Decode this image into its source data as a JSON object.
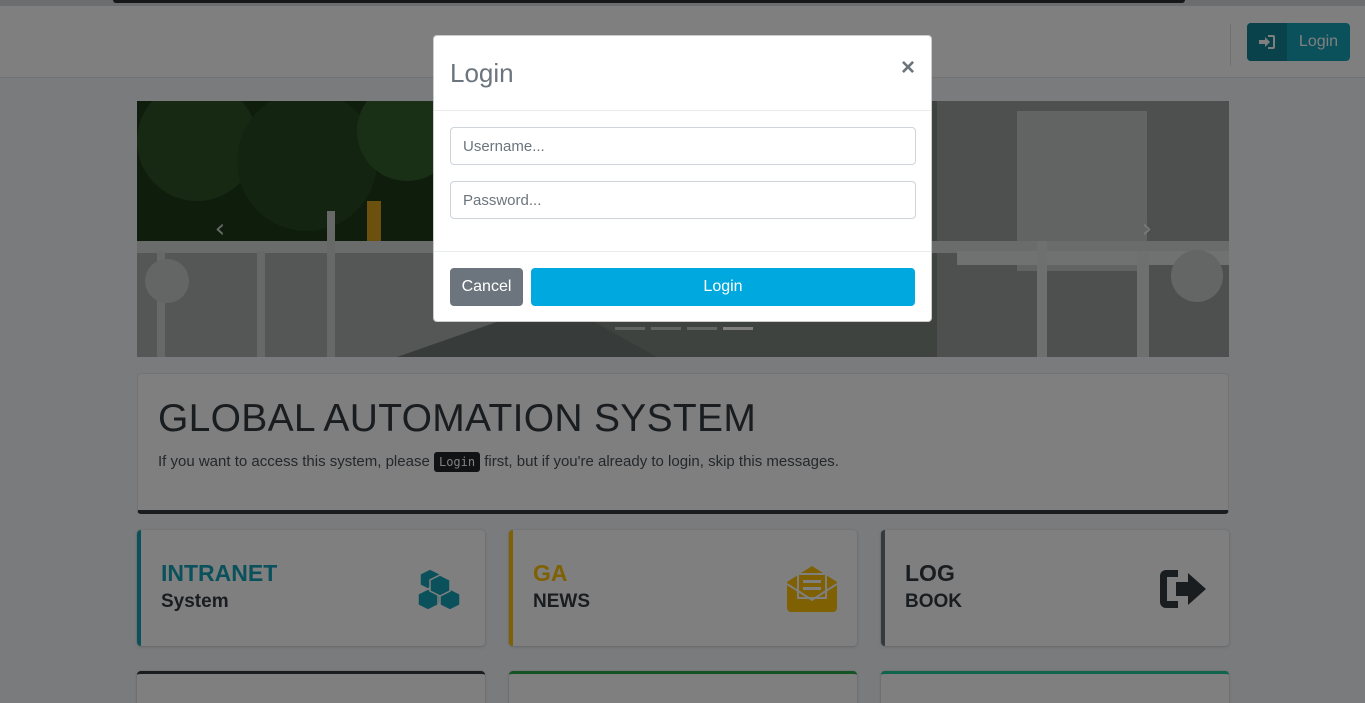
{
  "navbar": {
    "login_label": "Login",
    "login_icon": "sign-in-icon"
  },
  "carousel": {
    "prev_icon": "chevron-left-icon",
    "next_icon": "chevron-right-icon",
    "slide_count": 4,
    "active_index": 3
  },
  "jumbotron": {
    "title": "GLOBAL AUTOMATION SYSTEM",
    "text_before": "If you want to access this system, please ",
    "code": "Login",
    "text_after": " first, but if you're already to login, skip this messages."
  },
  "boxes": [
    {
      "line1": "INTRANET",
      "line2": "System",
      "icon": "cubes-icon",
      "color": "#17a2b8"
    },
    {
      "line1": "GA",
      "line2": "NEWS",
      "icon": "envelope-open-text-icon",
      "color": "#ffc107"
    },
    {
      "line1": "LOG",
      "line2": "BOOK",
      "icon": "sign-out-icon",
      "color": "#343a40"
    }
  ],
  "modal": {
    "title": "Login",
    "close": "×",
    "username_placeholder": "Username...",
    "password_placeholder": "Password...",
    "cancel_label": "Cancel",
    "login_label": "Login"
  }
}
